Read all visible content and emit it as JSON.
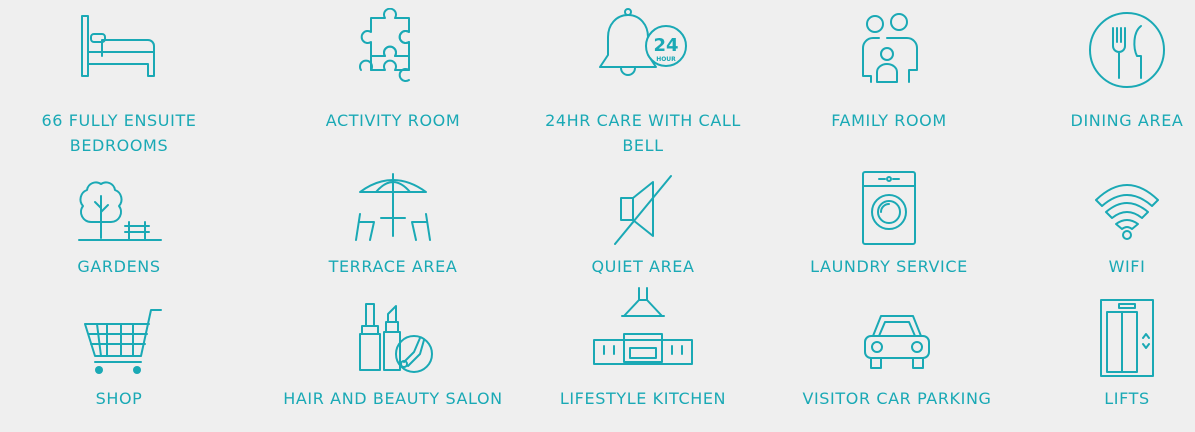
{
  "theme": {
    "accent": "#1aa9b5",
    "background": "#efefef"
  },
  "amenities": [
    {
      "label": "66 FULLY ENSUITE BEDROOMS",
      "icon": "bed-icon"
    },
    {
      "label": "ACTIVITY ROOM",
      "icon": "puzzle-icon"
    },
    {
      "label": "24HR CARE WITH CALL BELL",
      "icon": "bell-24-hour-icon",
      "badge_number": "24",
      "badge_text": "HOUR"
    },
    {
      "label": "FAMILY ROOM",
      "icon": "family-icon"
    },
    {
      "label": "DINING AREA",
      "icon": "fork-knife-icon"
    },
    {
      "label": "GARDENS",
      "icon": "tree-bench-icon"
    },
    {
      "label": "TERRACE AREA",
      "icon": "parasol-table-icon"
    },
    {
      "label": "QUIET AREA",
      "icon": "speaker-muted-icon"
    },
    {
      "label": "LAUNDRY SERVICE",
      "icon": "washing-machine-icon"
    },
    {
      "label": "WIFI",
      "icon": "wifi-icon"
    },
    {
      "label": "SHOP",
      "icon": "shopping-cart-icon"
    },
    {
      "label": "HAIR AND BEAUTY SALON",
      "icon": "cosmetics-scissors-icon"
    },
    {
      "label": "LIFESTYLE KITCHEN",
      "icon": "kitchen-hood-icon"
    },
    {
      "label": "VISITOR CAR PARKING",
      "icon": "car-icon"
    },
    {
      "label": "LIFTS",
      "icon": "lift-icon"
    }
  ]
}
